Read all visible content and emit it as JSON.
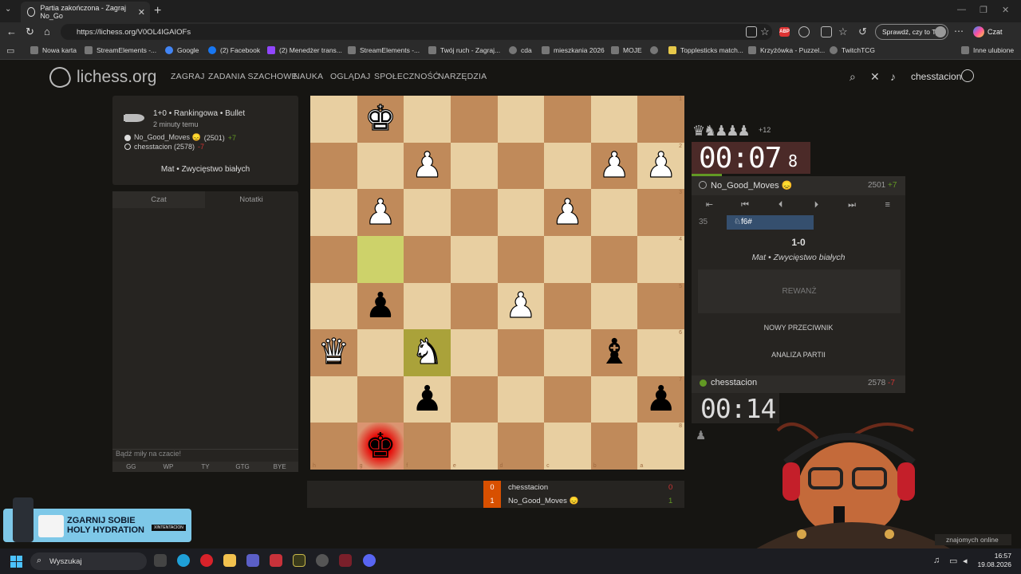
{
  "browser": {
    "tab_title": "Partia zakończona - Zagraj No_Go",
    "url": "https://lichess.org/V0OL4IGAIOFs",
    "sprawdz_label": "Sprawdź, czy to Ty",
    "chat_label": "Czat",
    "bookmarks": [
      "Nowa karta",
      "StreamElements -...",
      "Google",
      "(2) Facebook",
      "(2) Menedżer trans...",
      "StreamElements -...",
      "Twój ruch - Zagraj...",
      "cda",
      "mieszkania 2026",
      "MOJE",
      "Topplesticks match...",
      "Krzyżówka - Puzzel...",
      "TwitchTCG",
      "Inne ulubione"
    ]
  },
  "site": {
    "logo": "lichess.org",
    "nav": [
      "ZAGRAJ",
      "ZADANIA SZACHOWE",
      "NAUKA",
      "OGLĄDAJ",
      "SPOŁECZNOŚĆ",
      "NARZĘDZIA"
    ],
    "username": "chesstacion"
  },
  "game_info": {
    "title": "1+0 • Rankingowa • Bullet",
    "time_ago": "2 minuty temu",
    "white": {
      "name": "No_Good_Moves 😞",
      "rating": "(2501)",
      "diff": "+7"
    },
    "black": {
      "name": "chesstacion (2578)",
      "diff": "-7"
    },
    "result": "Mat • Zwycięstwo białych"
  },
  "chat": {
    "tabs": [
      "Czat",
      "Notatki"
    ],
    "placeholder": "Bądź miły na czacie!",
    "presets": [
      "GG",
      "WP",
      "TY",
      "GTG",
      "BYE"
    ]
  },
  "board": {
    "orientation": "black",
    "files": [
      "h",
      "g",
      "f",
      "e",
      "d",
      "c",
      "b",
      "a"
    ],
    "ranks": [
      "1",
      "2",
      "3",
      "4",
      "5",
      "6",
      "7",
      "8"
    ],
    "pieces": [
      [
        "",
        "wK",
        "",
        "",
        "",
        "",
        "",
        ""
      ],
      [
        "",
        "",
        "wP",
        "",
        "",
        "",
        "wP",
        "wP"
      ],
      [
        "",
        "wP",
        "",
        "",
        "",
        "wP",
        "",
        ""
      ],
      [
        "",
        "",
        "",
        "",
        "",
        "",
        "",
        ""
      ],
      [
        "",
        "bP",
        "",
        "",
        "wP",
        "",
        "",
        ""
      ],
      [
        "wQ",
        "",
        "wN",
        "",
        "",
        "",
        "bB",
        ""
      ],
      [
        "",
        "",
        "bP",
        "",
        "",
        "",
        "",
        "bP"
      ],
      [
        "",
        "bK",
        "",
        "",
        "",
        "",
        "",
        ""
      ]
    ],
    "last_move": [
      "g4",
      "f6"
    ],
    "check": "g8"
  },
  "scoreboard": [
    {
      "score": "0",
      "name": "chesstacion",
      "result": "0",
      "color": "#cc3333"
    },
    {
      "score": "1",
      "name": "No_Good_Moves 😞",
      "result": "1",
      "color": "#629924"
    }
  ],
  "right": {
    "opp_material": "♛♞♟♟♟",
    "opp_material_plus": "+12",
    "opp_clock": "00:07",
    "opp_clock_tenths": "8",
    "opp_name": "No_Good_Moves 😞",
    "opp_rating": "2501",
    "opp_diff": "+7",
    "move_number": "35",
    "move_text": "♘f6#",
    "result_score": "1-0",
    "result_desc": "Mat • Zwycięstwo białych",
    "rematch": "REWANŻ",
    "new_opponent": "NOWY PRZECIWNIK",
    "analysis": "ANALIZA PARTII",
    "me_name": "chesstacion",
    "me_rating": "2578",
    "me_diff": "-7",
    "me_clock": "00:14",
    "me_material": "♟",
    "controls": [
      "⇤",
      "⏮",
      "⏴",
      "⏵",
      "⏭",
      "≡"
    ]
  },
  "overlay": {
    "ad_text": "ZGARNIJ SOBIE HOLY HYDRATION",
    "ad_tag": "XINTENTACION",
    "friends": "znajomych online"
  },
  "taskbar": {
    "search": "Wyszukaj",
    "time": "16:57",
    "date": "19.08.2026"
  }
}
